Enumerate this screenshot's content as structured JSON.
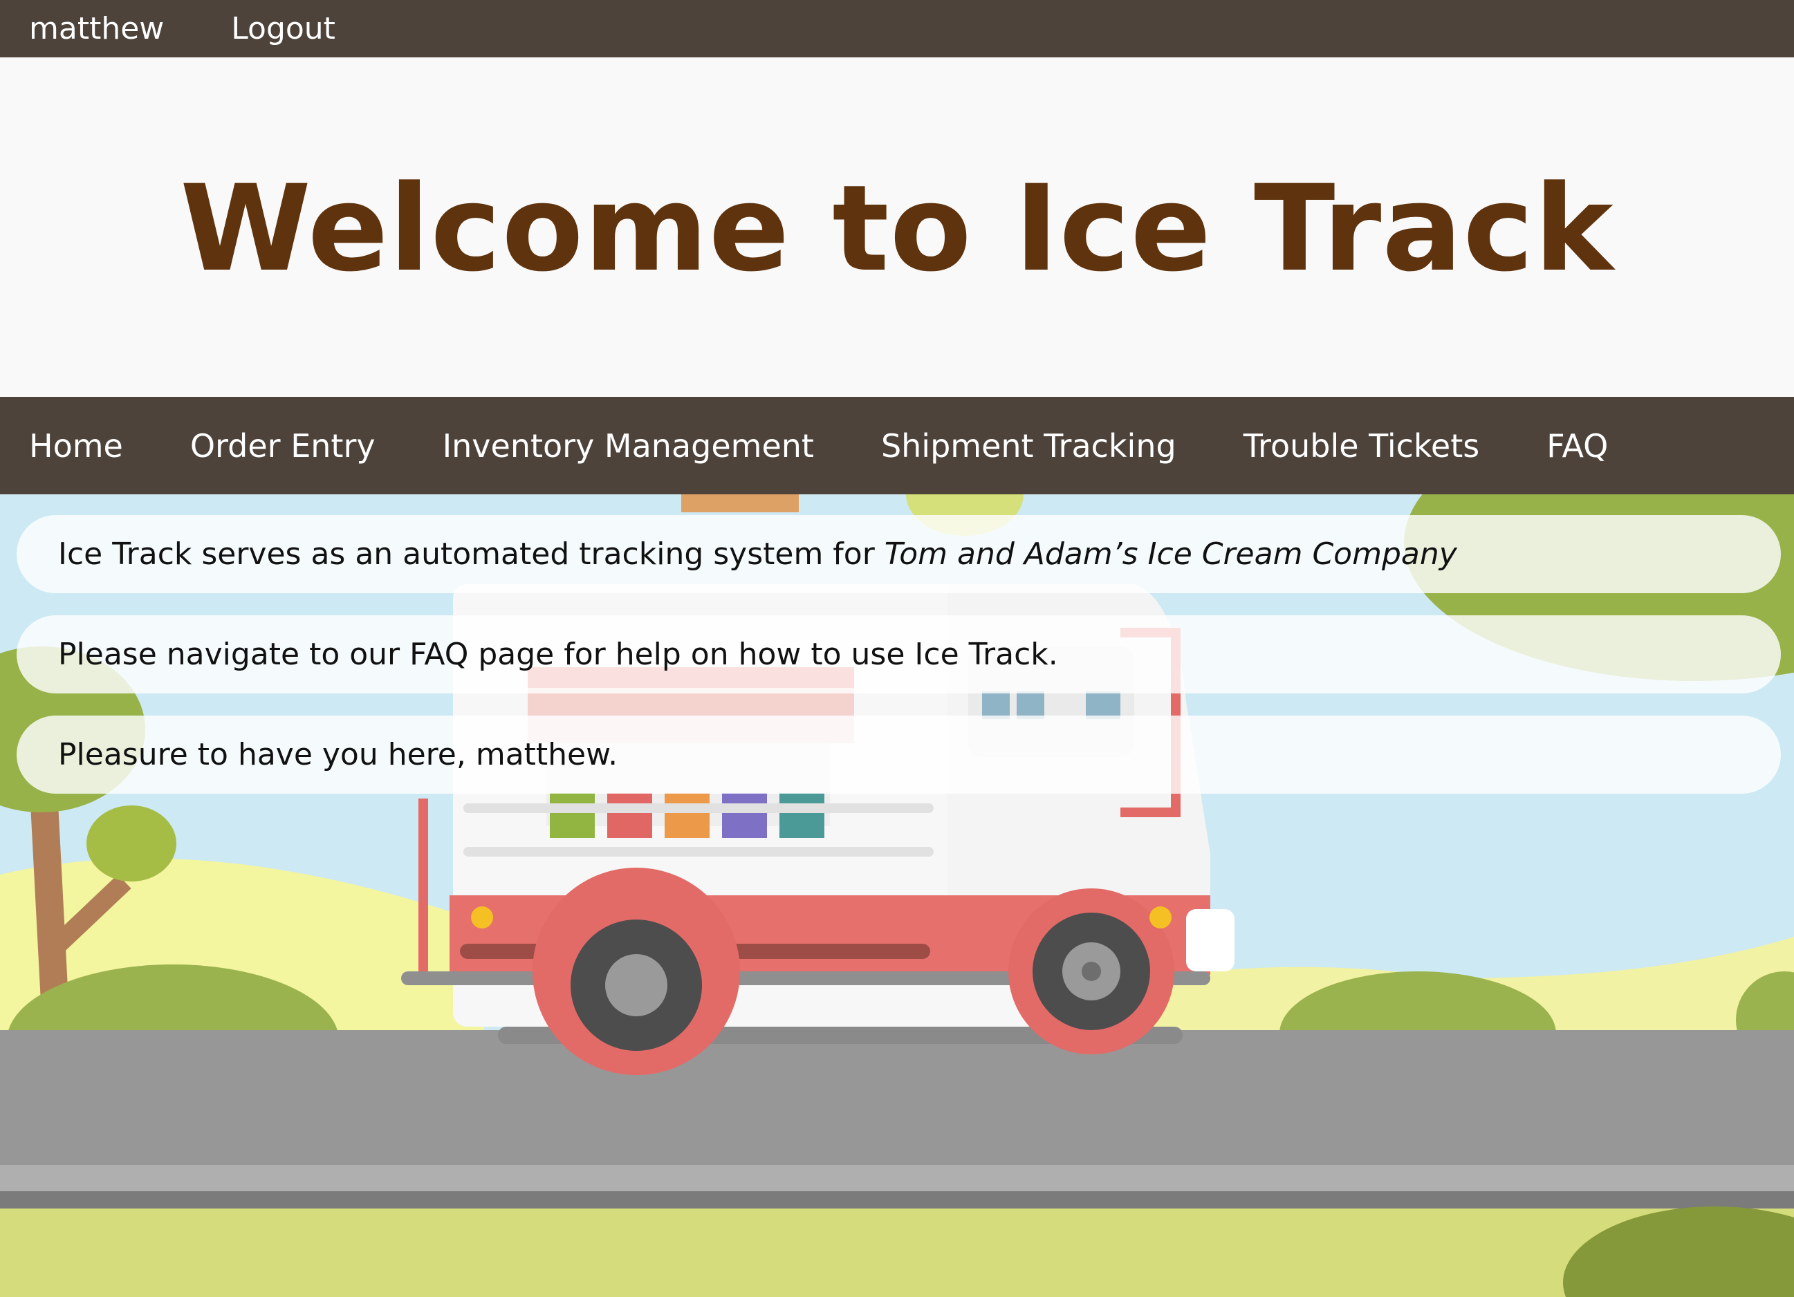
{
  "userbar": {
    "username": "matthew",
    "logout_label": "Logout"
  },
  "header": {
    "title": "Welcome to Ice Track"
  },
  "nav": {
    "items": [
      "Home",
      "Order Entry",
      "Inventory Management",
      "Shipment Tracking",
      "Trouble Tickets",
      "FAQ"
    ]
  },
  "messages": {
    "intro_prefix": "Ice Track serves as an automated tracking system for ",
    "intro_company": "Tom and Adam’s Ice Cream Company",
    "faq_hint": "Please navigate to our FAQ page for help on how to use Ice Track.",
    "greeting": "Pleasure to have you here, matthew."
  },
  "colors": {
    "bar": "#4d433a",
    "title": "#5f330d",
    "sky": "#cde9f4",
    "road": "#979797",
    "grass": "#d4dc7b"
  }
}
